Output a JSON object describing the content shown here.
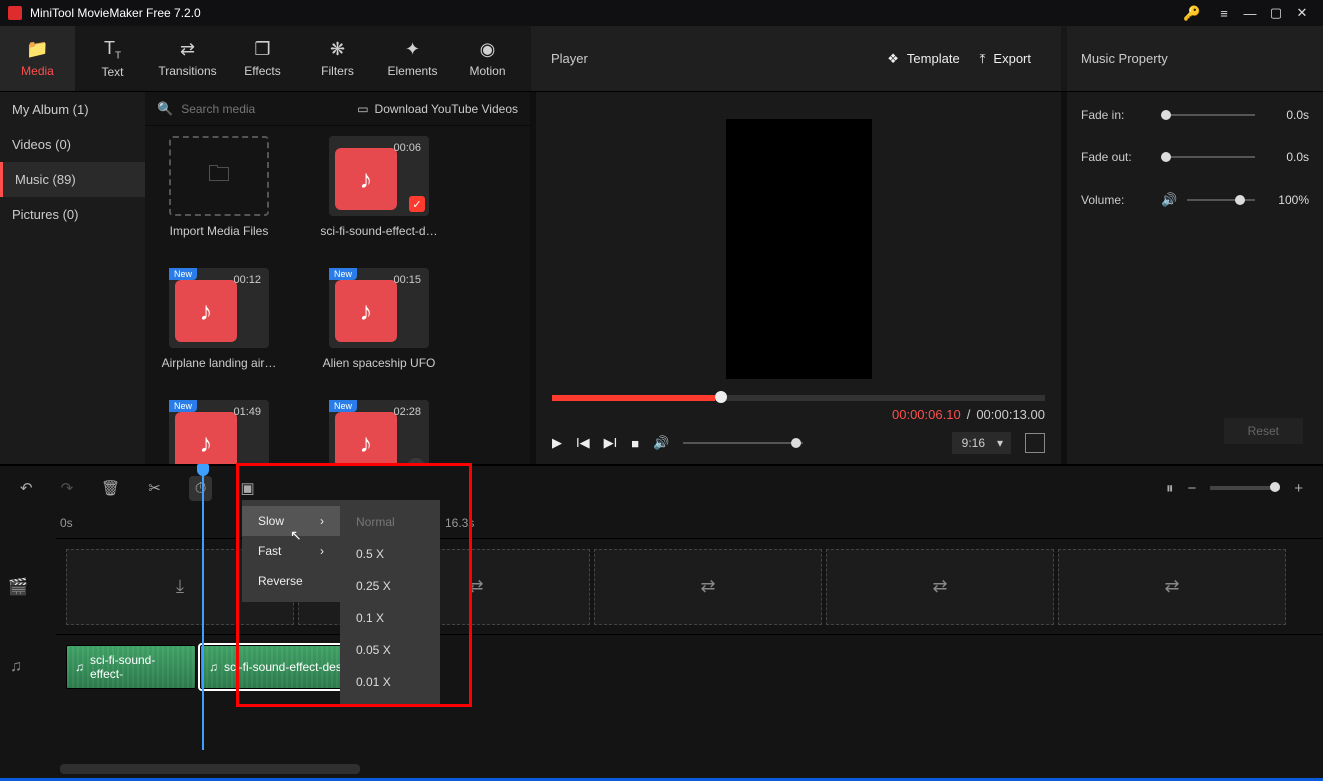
{
  "titlebar": {
    "title": "MiniTool MovieMaker Free 7.2.0"
  },
  "ribbon": {
    "tabs": [
      {
        "label": "Media"
      },
      {
        "label": "Text"
      },
      {
        "label": "Transitions"
      },
      {
        "label": "Effects"
      },
      {
        "label": "Filters"
      },
      {
        "label": "Elements"
      },
      {
        "label": "Motion"
      }
    ]
  },
  "player_header": {
    "label": "Player",
    "template": "Template",
    "export": "Export"
  },
  "property_header": {
    "title": "Music Property"
  },
  "sidebar": {
    "items": [
      {
        "label": "My Album (1)"
      },
      {
        "label": "Videos (0)"
      },
      {
        "label": "Music (89)"
      },
      {
        "label": "Pictures (0)"
      }
    ]
  },
  "search": {
    "placeholder": "Search media",
    "youtube": "Download YouTube Videos"
  },
  "thumbs": [
    {
      "name": "Import Media Files",
      "dur": "",
      "import": true
    },
    {
      "name": "sci-fi-sound-effect-d…",
      "dur": "00:06",
      "checked": true
    },
    {
      "name": "Airplane landing air…",
      "dur": "00:12",
      "new": true
    },
    {
      "name": "Alien spaceship UFO",
      "dur": "00:15",
      "new": true
    },
    {
      "name": "",
      "dur": "01:49",
      "new": true
    },
    {
      "name": "",
      "dur": "02:28",
      "new": true,
      "dl": true
    }
  ],
  "player": {
    "current": "00:00:06.10",
    "total": "00:00:13.00",
    "sep": "/",
    "ratio": "9:16"
  },
  "props": {
    "fadein_label": "Fade in:",
    "fadein_value": "0.0s",
    "fadeout_label": "Fade out:",
    "fadeout_value": "0.0s",
    "volume_label": "Volume:",
    "volume_value": "100%",
    "reset": "Reset"
  },
  "ruler": {
    "t0": "0s",
    "t1": "16.3s"
  },
  "speed_menu": {
    "items": [
      {
        "label": "Slow",
        "arrow": true,
        "hover": true
      },
      {
        "label": "Fast",
        "arrow": true
      },
      {
        "label": "Reverse"
      }
    ],
    "sub": [
      {
        "label": "Normal",
        "dim": true
      },
      {
        "label": "0.5 X"
      },
      {
        "label": "0.25 X"
      },
      {
        "label": "0.1 X"
      },
      {
        "label": "0.05 X"
      },
      {
        "label": "0.01 X"
      }
    ]
  },
  "audio": {
    "clip1": "sci-fi-sound-effect-",
    "clip2": "sci-fi-sound-effect-designed-ci"
  }
}
